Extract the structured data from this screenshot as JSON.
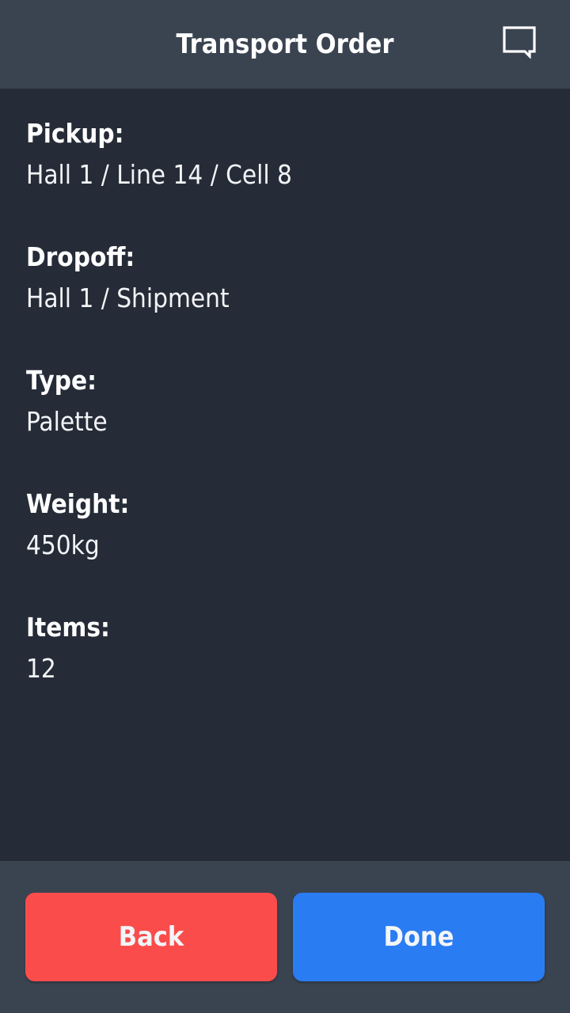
{
  "header": {
    "title": "Transport Order",
    "chat_icon": "chat-bubble-icon"
  },
  "fields": [
    {
      "label": "Pickup:",
      "value": "Hall 1 / Line 14 / Cell 8"
    },
    {
      "label": "Dropoff:",
      "value": "Hall 1 / Shipment"
    },
    {
      "label": "Type:",
      "value": "Palette"
    },
    {
      "label": "Weight:",
      "value": "450kg"
    },
    {
      "label": "Items:",
      "value": "12"
    }
  ],
  "footer": {
    "back_label": "Back",
    "done_label": "Done"
  },
  "colors": {
    "header_bg": "#3a4451",
    "content_bg": "#252b37",
    "back_button": "#fa4d4b",
    "done_button": "#2a7cf3"
  }
}
